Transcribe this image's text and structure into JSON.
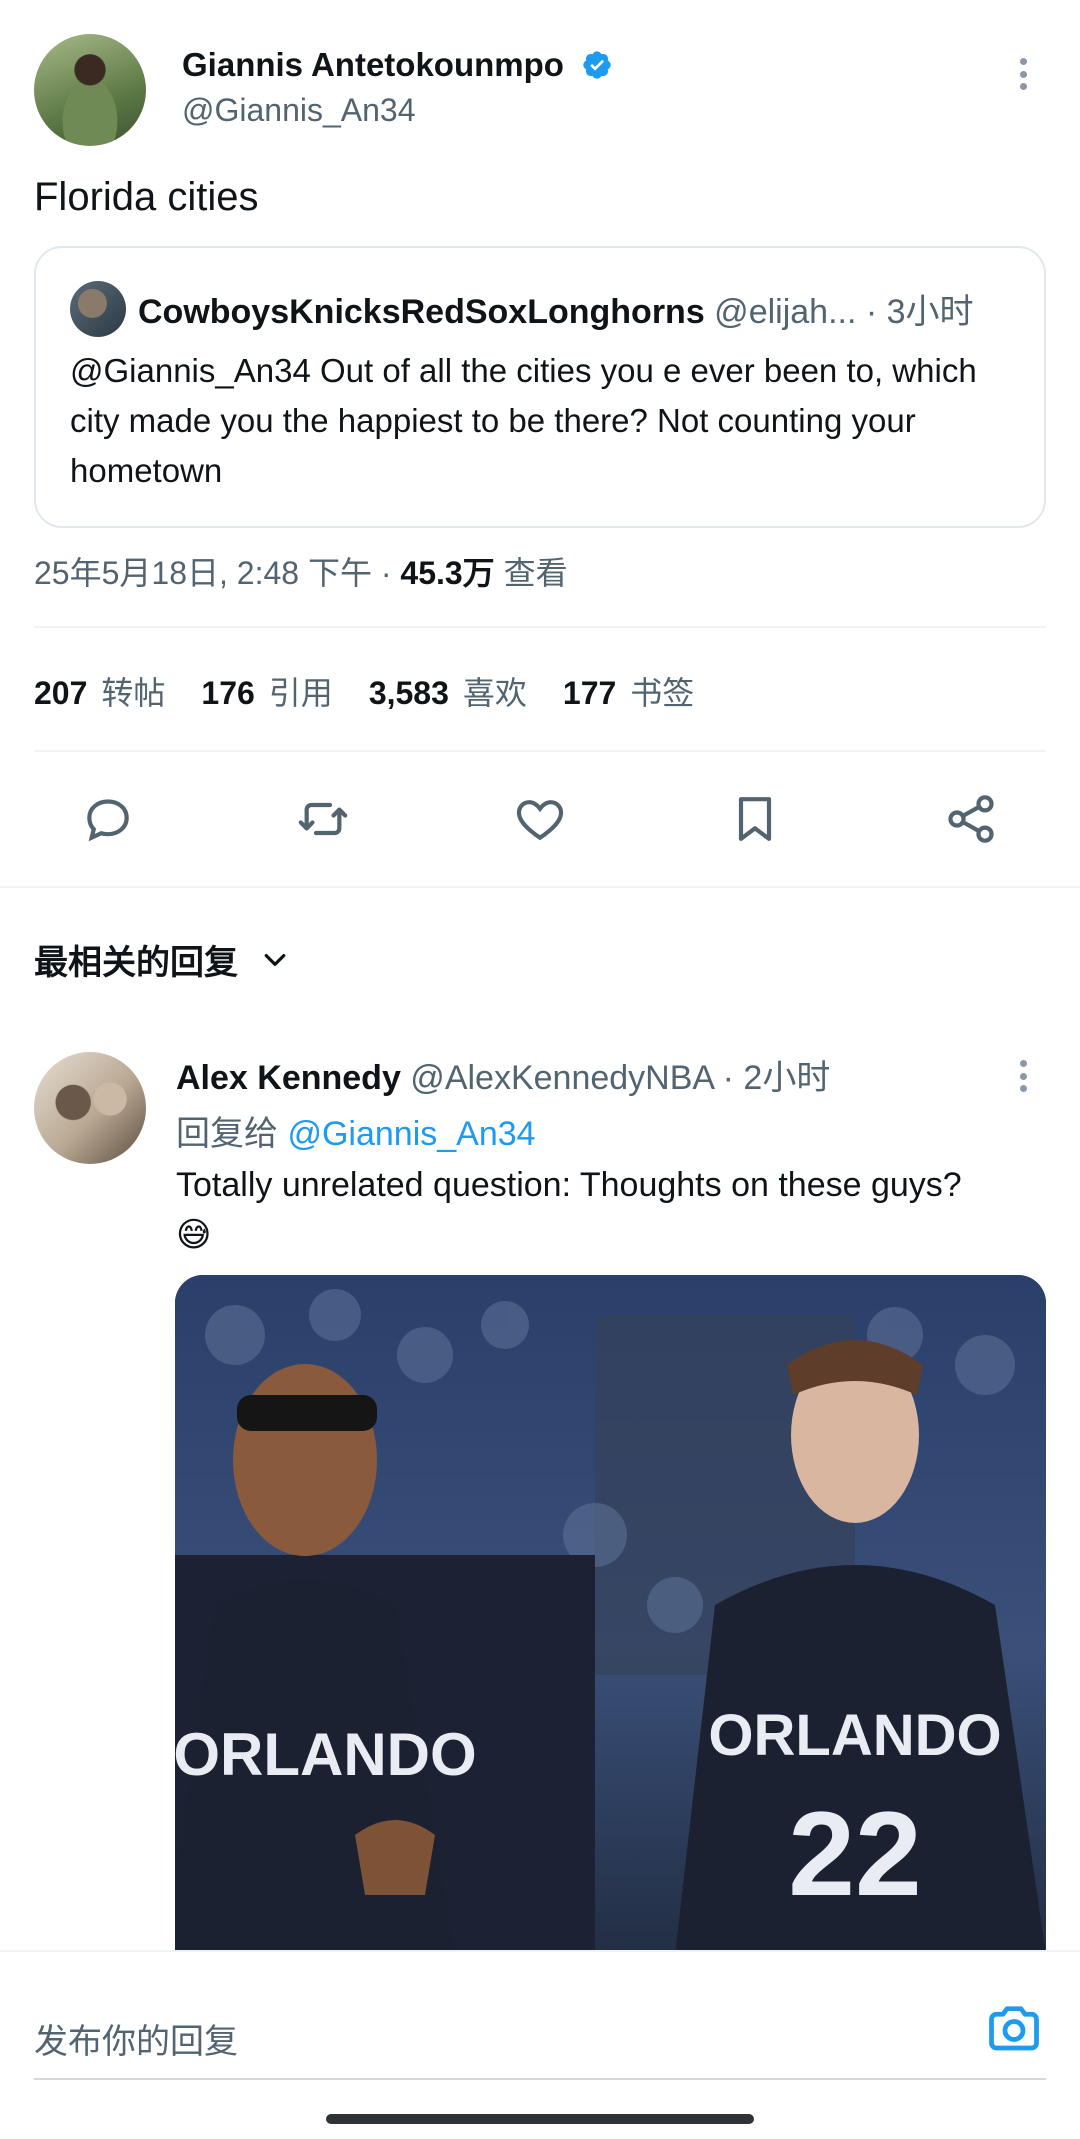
{
  "tweet": {
    "author_name": "Giannis Antetokounmpo",
    "author_handle": "@Giannis_An34",
    "text": "Florida cities",
    "quote": {
      "author_name": "CowboysKnicksRedSoxLonghorns",
      "meta": " @elijah... · 3小时",
      "text": "@Giannis_An34 Out of all the cities you e ever been to, which city made you the happiest to be there? Not counting your hometown"
    },
    "timestamp": "25年5月18日, 2:48 下午 · ",
    "views_value": "45.3万",
    "views_label": " 查看"
  },
  "stats": [
    {
      "value": "207",
      "label": "转帖"
    },
    {
      "value": "176",
      "label": "引用"
    },
    {
      "value": "3,583",
      "label": "喜欢"
    },
    {
      "value": "177",
      "label": "书签"
    }
  ],
  "actions": [
    "reply-icon",
    "retweet-icon",
    "like-icon",
    "bookmark-icon",
    "share-icon"
  ],
  "replies_section": {
    "sort_label": "最相关的回复"
  },
  "reply": {
    "author_name": "Alex Kennedy",
    "meta": " @AlexKennedyNBA · 2小时",
    "reply_to_prefix": "回复给 ",
    "reply_to_handle": "@Giannis_An34",
    "text": "Totally unrelated question: Thoughts on these guys?",
    "emoji": "😅"
  },
  "composer": {
    "placeholder": "发布你的回复"
  },
  "colors": {
    "accent": "#1d9bf0",
    "secondary_text": "#536471",
    "primary_text": "#0f1419",
    "divider": "#eff3f4"
  }
}
